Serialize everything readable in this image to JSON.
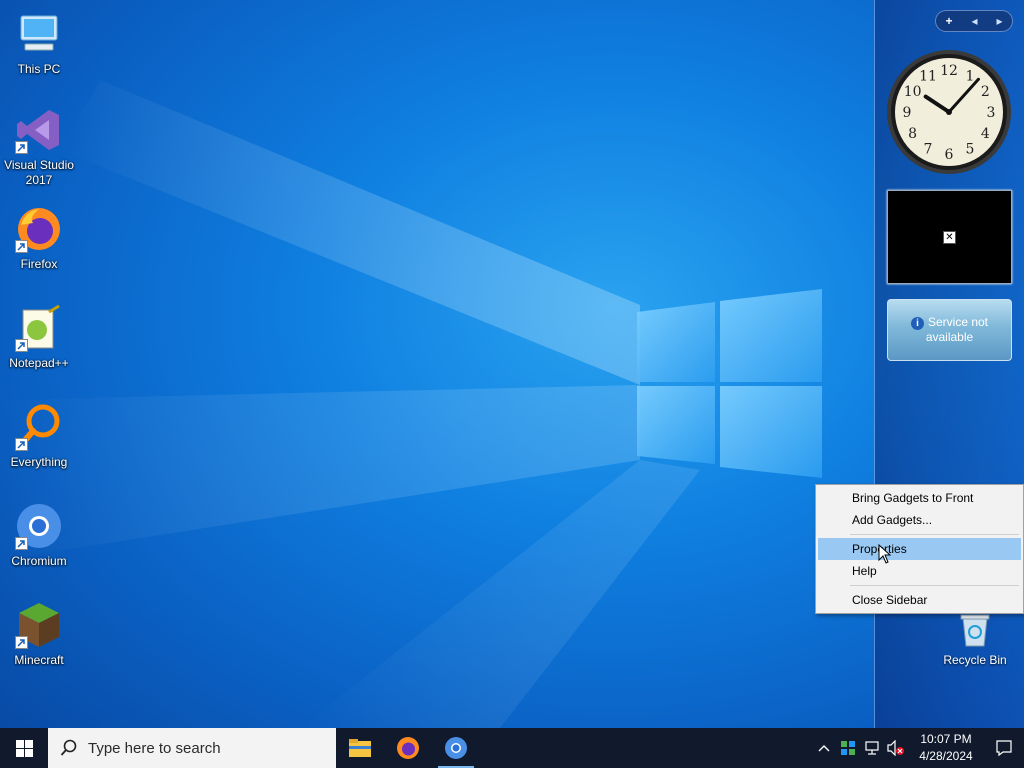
{
  "desktop_icons": [
    {
      "label": "This PC",
      "icon": "this-pc-icon"
    },
    {
      "label": "Visual Studio\n2017",
      "icon": "visual-studio-icon"
    },
    {
      "label": "Firefox",
      "icon": "firefox-icon"
    },
    {
      "label": "Notepad++",
      "icon": "notepadpp-icon"
    },
    {
      "label": "Everything",
      "icon": "everything-icon"
    },
    {
      "label": "Chromium",
      "icon": "chromium-icon"
    },
    {
      "label": "Minecraft",
      "icon": "minecraft-icon"
    }
  ],
  "sidebar": {
    "controls": [
      "+",
      "◂",
      "▸"
    ],
    "clock": {
      "hour": 10,
      "minute": 7,
      "numerals": [
        "12",
        "1",
        "2",
        "3",
        "4",
        "5",
        "6",
        "7",
        "8",
        "9",
        "10",
        "11"
      ]
    },
    "slideshow": {
      "broken_image_glyph": "✕"
    },
    "weather": {
      "icon": "info-icon",
      "info_glyph": "i",
      "line1": "Service not",
      "line2": "available"
    }
  },
  "recycle_bin": {
    "label": "Recycle Bin",
    "icon": "recycle-bin-icon"
  },
  "context_menu": {
    "items": [
      {
        "label": "Bring Gadgets to Front"
      },
      {
        "label": "Add Gadgets..."
      },
      {
        "label": "Properties"
      },
      {
        "label": "Help"
      },
      {
        "label": "Close Sidebar"
      }
    ],
    "highlighted": "Properties"
  },
  "taskbar": {
    "search_placeholder": "Type here to search",
    "apps": [
      "file-explorer-icon",
      "firefox-icon",
      "chromium-icon"
    ],
    "tray": {
      "overflow": "chevron-up-icon",
      "time": "10:07 PM",
      "date": "4/28/2024"
    }
  },
  "colors": {
    "accent": "#0f7fe0",
    "taskbar": "#101a2c",
    "menu_highlight": "#99c9f2"
  }
}
